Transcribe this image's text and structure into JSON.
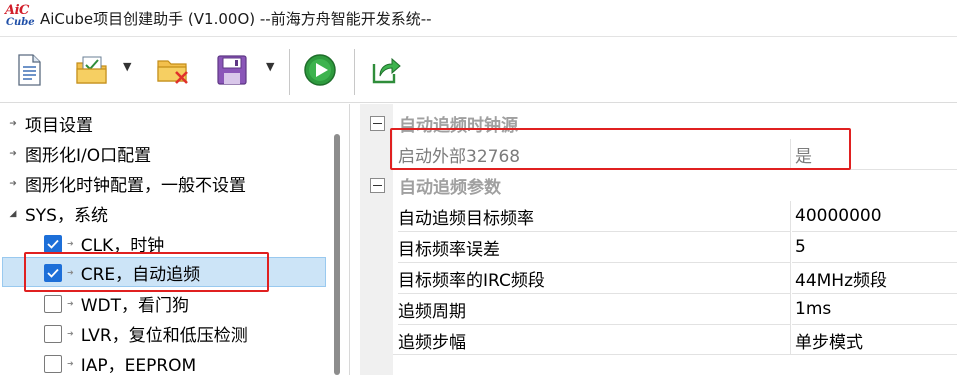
{
  "window": {
    "title": "AiCube项目创建助手 (V1.00O) --前海方舟智能开发系统--",
    "logo_top": "AiC",
    "logo_bottom": "Cube"
  },
  "toolbar": {
    "buttons": [
      {
        "icon": "new-file-icon"
      },
      {
        "icon": "open-project-icon"
      },
      {
        "icon": "close-project-icon"
      },
      {
        "icon": "save-icon"
      },
      {
        "icon": "run-icon"
      },
      {
        "icon": "export-icon"
      }
    ],
    "dropdown_glyph": "▼"
  },
  "tree": {
    "items": [
      {
        "label": "项目设置",
        "arrow": "➜"
      },
      {
        "label": "图形化I/O口配置",
        "arrow": "➜"
      },
      {
        "label": "图形化时钟配置，一般不设置",
        "arrow": "➜"
      },
      {
        "label": "SYS，系统",
        "arrow": "◢"
      }
    ],
    "children": [
      {
        "label": "CLK，时钟",
        "checked": true,
        "arrow": "➜"
      },
      {
        "label": "CRE，自动追频",
        "checked": true,
        "arrow": "➜",
        "selected": true
      },
      {
        "label": "WDT，看门狗",
        "checked": false,
        "arrow": "➜"
      },
      {
        "label": "LVR，复位和低压检测",
        "checked": false,
        "arrow": "➜"
      },
      {
        "label": "IAP，EEPROM",
        "checked": false,
        "arrow": "➜"
      }
    ]
  },
  "grid": {
    "categories": [
      {
        "label": "自动追频时钟源"
      },
      {
        "label": "自动追频参数"
      }
    ],
    "clock_source": [
      {
        "name": "启动外部32768",
        "value": "是"
      }
    ],
    "params": [
      {
        "name": "自动追频目标频率",
        "value": "40000000"
      },
      {
        "name": "目标频率误差",
        "value": "5"
      },
      {
        "name": "目标频率的IRC频段",
        "value": "44MHz频段"
      },
      {
        "name": "追频周期",
        "value": "1ms"
      },
      {
        "name": "追频步幅",
        "value": "单步模式"
      }
    ]
  },
  "colors": {
    "highlight": "#e02020",
    "checkbox": "#1d6fd8",
    "selection": "#cce4f7"
  }
}
